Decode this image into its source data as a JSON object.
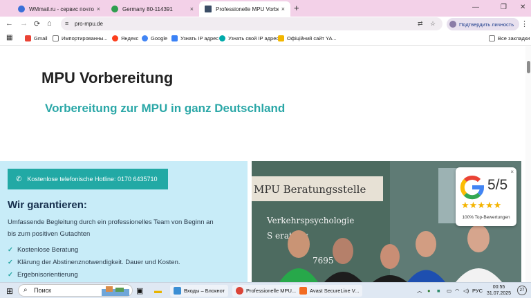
{
  "browser": {
    "tabs": [
      {
        "title": "WMmail.ru - сервис почтовых",
        "close": "×",
        "favicon_color": "#3a6fd8",
        "active": false
      },
      {
        "title": "Germany 80-114391",
        "close": "×",
        "favicon_color": "#2f9e4f",
        "active": false
      },
      {
        "title": "Professionelle MPU Vorbereitu",
        "close": "×",
        "favicon_color": "#3b4d66",
        "active": true
      }
    ],
    "new_tab": "+",
    "window_controls": {
      "minimize": "—",
      "restore": "❐",
      "close": "✕"
    },
    "nav": {
      "back": "←",
      "forward": "→",
      "reload": "⟳",
      "home": "⌂"
    },
    "url": "pro-mpu.de",
    "verify_label": "Подтвердить личность",
    "menu": "⋮",
    "bookmarks": [
      {
        "label": "Gmail",
        "color": "#ea4335"
      },
      {
        "label": "Импортированны...",
        "color": "#777"
      },
      {
        "label": "Яндекс",
        "color": "#fc3f1d"
      },
      {
        "label": "Google",
        "color": "#4285f4"
      },
      {
        "label": "Узнать IP адрес",
        "color": "#3b82f6"
      },
      {
        "label": "Узнать свой IP адрес",
        "color": "#0aa"
      },
      {
        "label": "Офіційний сайт YA...",
        "color": "#f2b600"
      }
    ],
    "all_bookmarks": "Все закладки"
  },
  "page": {
    "title": "MPU Vorbereitung",
    "subtitle": "Vorbereitung zur MPU in ganz Deutschland",
    "hotline": "Kostenlose telefonische Hotline: 0170 6435710",
    "guarantee_heading": "Wir garantieren:",
    "guarantee_text": "Umfassende Begleitung durch ein professionelles Team von Beginn an bis zum positiven Gutachten",
    "checks": [
      "Kostenlose Beratung",
      "Klärung der Abstinenznotwendigkeit. Dauer und Kosten.",
      "Ergebnisorientierung"
    ],
    "photo": {
      "sign_title": "MPU Beratungsstelle",
      "sign_line1": "Verkehrspsychologie",
      "sign_line2": "S   eratung",
      "sign_phone": "7695"
    },
    "rating": {
      "score": "5/5",
      "stars": "★★★★★",
      "label": "100% Top-Bewertungen",
      "close": "×"
    }
  },
  "taskbar": {
    "search_placeholder": "Поиск",
    "apps": [
      {
        "label": "Входы – Блокнот",
        "color": "#3c8fd4",
        "open": true
      },
      {
        "label": "Professionelle MPU...",
        "color": "#db4437",
        "open": true
      },
      {
        "label": "Avast SecureLine V...",
        "color": "#f26b21",
        "open": true
      }
    ],
    "lang": "РУС",
    "time": "00:55",
    "date": "31.07.2025",
    "notif": "27"
  }
}
